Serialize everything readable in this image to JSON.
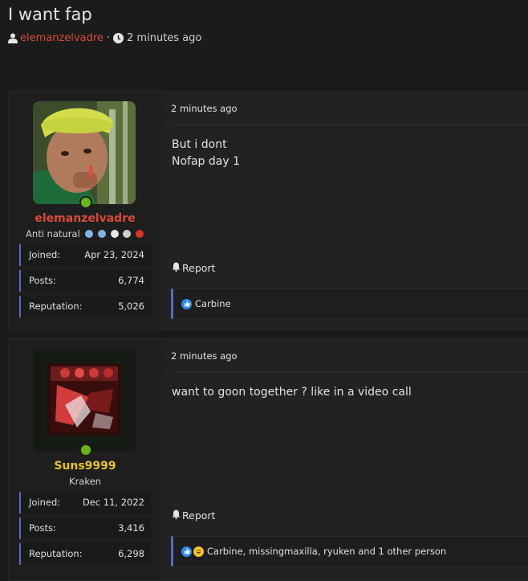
{
  "thread": {
    "title": "I want fap",
    "author": "elemanzelvadre",
    "separator": "·",
    "time": "2 minutes ago"
  },
  "posts": [
    {
      "username": "elemanzelvadre",
      "username_color": "#d94a3a",
      "user_title": "Anti natural",
      "title_emojis": [
        "cold-face-icon",
        "cold-face-icon",
        "skull-icon",
        "skull-crossbones-icon",
        "devil-icon"
      ],
      "stats": [
        {
          "label": "Joined:",
          "value": "Apr 23, 2024"
        },
        {
          "label": "Posts:",
          "value": "6,774"
        },
        {
          "label": "Reputation:",
          "value": "5,026"
        }
      ],
      "date": "2 minutes ago",
      "body": "But i dont\nNofap day 1",
      "report_label": "Report",
      "reactions": "Carbine",
      "reaction_icons": [
        "like-icon"
      ]
    },
    {
      "username": "Suns9999",
      "username_color": "#e9c229",
      "user_title": "Kraken",
      "stats": [
        {
          "label": "Joined:",
          "value": "Dec 11, 2022"
        },
        {
          "label": "Posts:",
          "value": "3,416"
        },
        {
          "label": "Reputation:",
          "value": "6,298"
        }
      ],
      "date": "2 minutes ago",
      "body": "want to goon together ? like in a video call",
      "report_label": "Report",
      "reactions": "Carbine, missingmaxilla, ryuken and 1 other person",
      "reaction_icons": [
        "like-icon",
        "laugh-icon"
      ]
    }
  ],
  "colors": {
    "background": "#1b1b1b",
    "accent_border": "#5b6abf",
    "online": "#6cb41e"
  }
}
